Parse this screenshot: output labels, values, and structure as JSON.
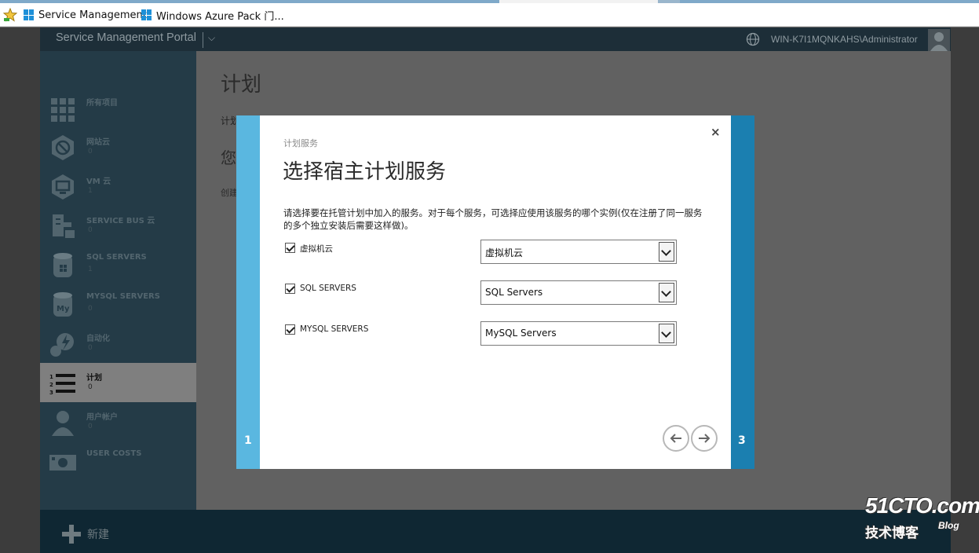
{
  "browser": {
    "favorites": [
      {
        "label": "Service Management",
        "icon": "windows-icon"
      },
      {
        "label": "Windows Azure Pack 门...",
        "icon": "windows-icon"
      }
    ]
  },
  "portal": {
    "brand": "Service Management Portal",
    "user": "WIN-K7I1MQNKAHS\\Administrator",
    "nav": [
      {
        "label": "所有项目",
        "count": "",
        "icon": "grid-icon"
      },
      {
        "label": "网站云",
        "count": "0",
        "icon": "website-cloud-icon"
      },
      {
        "label": "VM 云",
        "count": "1",
        "icon": "vm-cloud-icon"
      },
      {
        "label": "SERVICE BUS 云",
        "count": "0",
        "icon": "service-bus-icon"
      },
      {
        "label": "SQL SERVERS",
        "count": "1",
        "icon": "sql-server-icon"
      },
      {
        "label": "MYSQL SERVERS",
        "count": "0",
        "icon": "mysql-server-icon"
      },
      {
        "label": "自动化",
        "count": "0",
        "icon": "automation-icon"
      },
      {
        "label": "计划",
        "count": "0",
        "icon": "plans-icon"
      },
      {
        "label": "用户帐户",
        "count": "0",
        "icon": "user-accounts-icon"
      },
      {
        "label": "USER COSTS",
        "count": "",
        "icon": "user-costs-icon"
      }
    ],
    "main": {
      "title": "计划",
      "line": "计划",
      "big": "您",
      "small": "创建"
    },
    "bottom": {
      "new_label": "新建"
    }
  },
  "dialog": {
    "subtitle": "计划服务",
    "title": "选择宿主计划服务",
    "description": "请选择要在托管计划中加入的服务。对于每个服务，可选择应使用该服务的哪个实例(仅在注册了同一服务的多个独立安装后需要这样做)。",
    "services": [
      {
        "label": "虚拟机云",
        "checked": true,
        "selected": "虚拟机云"
      },
      {
        "label": "SQL SERVERS",
        "checked": true,
        "selected": "SQL Servers"
      },
      {
        "label": "MYSQL SERVERS",
        "checked": true,
        "selected": "MySQL Servers"
      }
    ],
    "step_left": "1",
    "step_right": "3",
    "close_glyph": "×"
  },
  "watermark": {
    "line1": "51CTO.com",
    "line2": "技术博客",
    "line3": "Blog"
  },
  "colors": {
    "sidebar": "#243b47",
    "header": "#1d2e38",
    "step_left": "#5ab7e0",
    "step_right": "#1b7fb0"
  }
}
